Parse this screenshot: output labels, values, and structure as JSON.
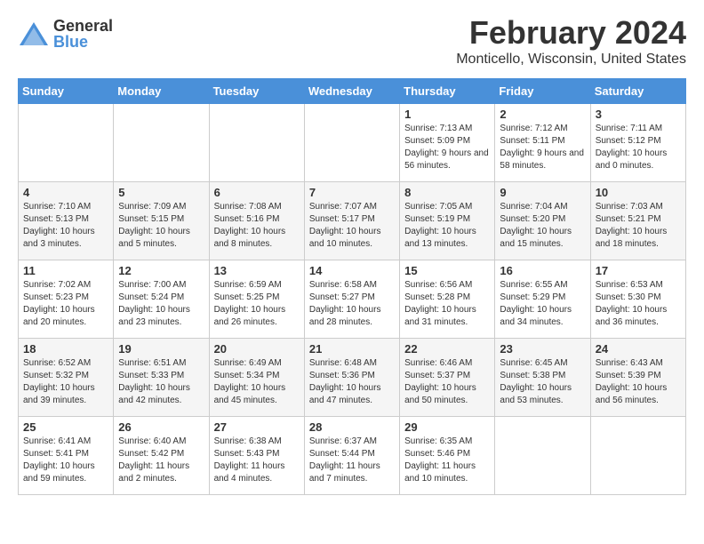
{
  "header": {
    "logo_general": "General",
    "logo_blue": "Blue",
    "month_title": "February 2024",
    "location": "Monticello, Wisconsin, United States"
  },
  "days_of_week": [
    "Sunday",
    "Monday",
    "Tuesday",
    "Wednesday",
    "Thursday",
    "Friday",
    "Saturday"
  ],
  "weeks": [
    [
      {
        "day": "",
        "sunrise": "",
        "sunset": "",
        "daylight": ""
      },
      {
        "day": "",
        "sunrise": "",
        "sunset": "",
        "daylight": ""
      },
      {
        "day": "",
        "sunrise": "",
        "sunset": "",
        "daylight": ""
      },
      {
        "day": "",
        "sunrise": "",
        "sunset": "",
        "daylight": ""
      },
      {
        "day": "1",
        "sunrise": "Sunrise: 7:13 AM",
        "sunset": "Sunset: 5:09 PM",
        "daylight": "Daylight: 9 hours and 56 minutes."
      },
      {
        "day": "2",
        "sunrise": "Sunrise: 7:12 AM",
        "sunset": "Sunset: 5:11 PM",
        "daylight": "Daylight: 9 hours and 58 minutes."
      },
      {
        "day": "3",
        "sunrise": "Sunrise: 7:11 AM",
        "sunset": "Sunset: 5:12 PM",
        "daylight": "Daylight: 10 hours and 0 minutes."
      }
    ],
    [
      {
        "day": "4",
        "sunrise": "Sunrise: 7:10 AM",
        "sunset": "Sunset: 5:13 PM",
        "daylight": "Daylight: 10 hours and 3 minutes."
      },
      {
        "day": "5",
        "sunrise": "Sunrise: 7:09 AM",
        "sunset": "Sunset: 5:15 PM",
        "daylight": "Daylight: 10 hours and 5 minutes."
      },
      {
        "day": "6",
        "sunrise": "Sunrise: 7:08 AM",
        "sunset": "Sunset: 5:16 PM",
        "daylight": "Daylight: 10 hours and 8 minutes."
      },
      {
        "day": "7",
        "sunrise": "Sunrise: 7:07 AM",
        "sunset": "Sunset: 5:17 PM",
        "daylight": "Daylight: 10 hours and 10 minutes."
      },
      {
        "day": "8",
        "sunrise": "Sunrise: 7:05 AM",
        "sunset": "Sunset: 5:19 PM",
        "daylight": "Daylight: 10 hours and 13 minutes."
      },
      {
        "day": "9",
        "sunrise": "Sunrise: 7:04 AM",
        "sunset": "Sunset: 5:20 PM",
        "daylight": "Daylight: 10 hours and 15 minutes."
      },
      {
        "day": "10",
        "sunrise": "Sunrise: 7:03 AM",
        "sunset": "Sunset: 5:21 PM",
        "daylight": "Daylight: 10 hours and 18 minutes."
      }
    ],
    [
      {
        "day": "11",
        "sunrise": "Sunrise: 7:02 AM",
        "sunset": "Sunset: 5:23 PM",
        "daylight": "Daylight: 10 hours and 20 minutes."
      },
      {
        "day": "12",
        "sunrise": "Sunrise: 7:00 AM",
        "sunset": "Sunset: 5:24 PM",
        "daylight": "Daylight: 10 hours and 23 minutes."
      },
      {
        "day": "13",
        "sunrise": "Sunrise: 6:59 AM",
        "sunset": "Sunset: 5:25 PM",
        "daylight": "Daylight: 10 hours and 26 minutes."
      },
      {
        "day": "14",
        "sunrise": "Sunrise: 6:58 AM",
        "sunset": "Sunset: 5:27 PM",
        "daylight": "Daylight: 10 hours and 28 minutes."
      },
      {
        "day": "15",
        "sunrise": "Sunrise: 6:56 AM",
        "sunset": "Sunset: 5:28 PM",
        "daylight": "Daylight: 10 hours and 31 minutes."
      },
      {
        "day": "16",
        "sunrise": "Sunrise: 6:55 AM",
        "sunset": "Sunset: 5:29 PM",
        "daylight": "Daylight: 10 hours and 34 minutes."
      },
      {
        "day": "17",
        "sunrise": "Sunrise: 6:53 AM",
        "sunset": "Sunset: 5:30 PM",
        "daylight": "Daylight: 10 hours and 36 minutes."
      }
    ],
    [
      {
        "day": "18",
        "sunrise": "Sunrise: 6:52 AM",
        "sunset": "Sunset: 5:32 PM",
        "daylight": "Daylight: 10 hours and 39 minutes."
      },
      {
        "day": "19",
        "sunrise": "Sunrise: 6:51 AM",
        "sunset": "Sunset: 5:33 PM",
        "daylight": "Daylight: 10 hours and 42 minutes."
      },
      {
        "day": "20",
        "sunrise": "Sunrise: 6:49 AM",
        "sunset": "Sunset: 5:34 PM",
        "daylight": "Daylight: 10 hours and 45 minutes."
      },
      {
        "day": "21",
        "sunrise": "Sunrise: 6:48 AM",
        "sunset": "Sunset: 5:36 PM",
        "daylight": "Daylight: 10 hours and 47 minutes."
      },
      {
        "day": "22",
        "sunrise": "Sunrise: 6:46 AM",
        "sunset": "Sunset: 5:37 PM",
        "daylight": "Daylight: 10 hours and 50 minutes."
      },
      {
        "day": "23",
        "sunrise": "Sunrise: 6:45 AM",
        "sunset": "Sunset: 5:38 PM",
        "daylight": "Daylight: 10 hours and 53 minutes."
      },
      {
        "day": "24",
        "sunrise": "Sunrise: 6:43 AM",
        "sunset": "Sunset: 5:39 PM",
        "daylight": "Daylight: 10 hours and 56 minutes."
      }
    ],
    [
      {
        "day": "25",
        "sunrise": "Sunrise: 6:41 AM",
        "sunset": "Sunset: 5:41 PM",
        "daylight": "Daylight: 10 hours and 59 minutes."
      },
      {
        "day": "26",
        "sunrise": "Sunrise: 6:40 AM",
        "sunset": "Sunset: 5:42 PM",
        "daylight": "Daylight: 11 hours and 2 minutes."
      },
      {
        "day": "27",
        "sunrise": "Sunrise: 6:38 AM",
        "sunset": "Sunset: 5:43 PM",
        "daylight": "Daylight: 11 hours and 4 minutes."
      },
      {
        "day": "28",
        "sunrise": "Sunrise: 6:37 AM",
        "sunset": "Sunset: 5:44 PM",
        "daylight": "Daylight: 11 hours and 7 minutes."
      },
      {
        "day": "29",
        "sunrise": "Sunrise: 6:35 AM",
        "sunset": "Sunset: 5:46 PM",
        "daylight": "Daylight: 11 hours and 10 minutes."
      },
      {
        "day": "",
        "sunrise": "",
        "sunset": "",
        "daylight": ""
      },
      {
        "day": "",
        "sunrise": "",
        "sunset": "",
        "daylight": ""
      }
    ]
  ]
}
